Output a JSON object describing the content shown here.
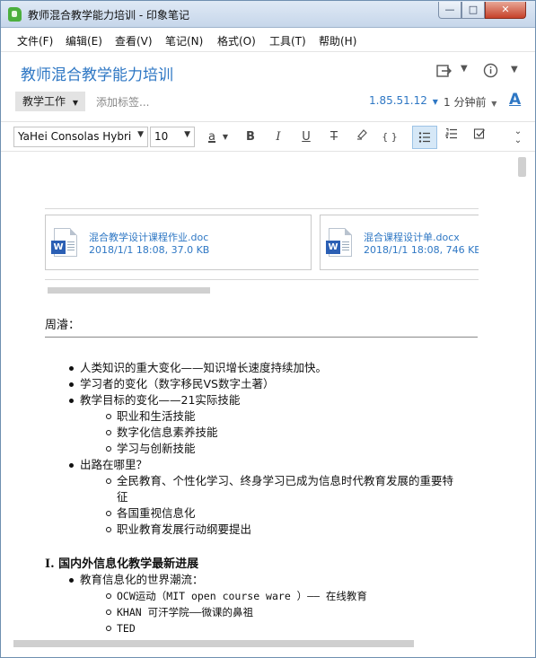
{
  "window": {
    "title": "教师混合教学能力培训 - 印象笔记",
    "min": "—",
    "max": "□",
    "close": "✕"
  },
  "menu": [
    "文件(F)",
    "编辑(E)",
    "查看(V)",
    "笔记(N)",
    "格式(O)",
    "工具(T)",
    "帮助(H)"
  ],
  "note": {
    "title": "教师混合教学能力培训",
    "notebook": "教学工作",
    "tag_placeholder": "添加标签...",
    "ip": "1.85.51.12",
    "time": "1 分钟前",
    "font_size_icon": "A"
  },
  "toolbar": {
    "font_family": "YaHei Consolas Hybri",
    "font_size": "10",
    "text_color_letter": "a",
    "bold": "B",
    "italic": "I",
    "underline": "U",
    "strike": "T",
    "code": "{ }"
  },
  "attachments": [
    {
      "name": "混合教学设计课程作业.doc",
      "meta": "2018/1/1 18:08, 37.0 KB",
      "badge": "W"
    },
    {
      "name": "混合课程设计单.docx",
      "meta": "2018/1/1 18:08, 746 KB",
      "badge": "W"
    }
  ],
  "body": {
    "section_label": "周濬：",
    "list": [
      {
        "level": 1,
        "text": "人类知识的重大变化——知识增长速度持续加快。"
      },
      {
        "level": 1,
        "text": "学习者的变化（数字移民VS数字土著）"
      },
      {
        "level": 1,
        "text": "教学目标的变化——21实际技能"
      },
      {
        "level": 2,
        "text": "职业和生活技能"
      },
      {
        "level": 2,
        "text": "数字化信息素养技能"
      },
      {
        "level": 2,
        "text": "学习与创新技能"
      },
      {
        "level": 1,
        "text": "出路在哪里？"
      },
      {
        "level": 2,
        "text": "全民教育、个性化学习、终身学习已成为信息时代教育发展的重要特"
      },
      {
        "level": 3,
        "text": "征"
      },
      {
        "level": 2,
        "text": "各国重视信息化"
      },
      {
        "level": 2,
        "text": "职业教育发展行动纲要提出"
      }
    ],
    "heading": "I. 国内外信息化教学最新进展",
    "list2": [
      {
        "level": 1,
        "text": "教育信息化的世界潮流："
      },
      {
        "level": 2,
        "text": "OCW运动（MIT open course ware ）—— 在线教育"
      },
      {
        "level": 2,
        "text": "KHAN 可汗学院——微课的鼻祖"
      },
      {
        "level": 2,
        "text": "TED"
      }
    ]
  }
}
